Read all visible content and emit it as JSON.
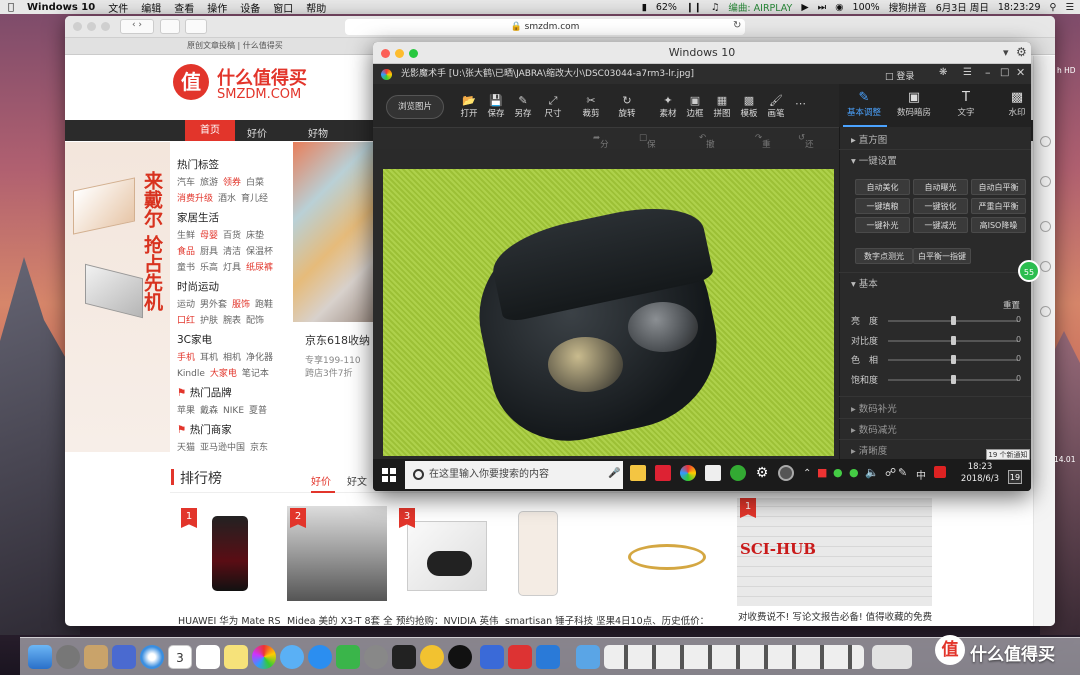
{
  "menubar": {
    "app": "Windows 10",
    "items": [
      "文件",
      "编辑",
      "查看",
      "操作",
      "设备",
      "窗口",
      "帮助"
    ],
    "battery_pct": "62%",
    "input": "编曲: AIRPLAY",
    "battery_status": "100%",
    "search_app": "搜狗拼音",
    "date": "6月3日 周日",
    "time": "18:23:29"
  },
  "safari": {
    "url": "smzdm.com",
    "tab_hint": "原创文章投稿 | 什么值得买"
  },
  "smzdm": {
    "logo_char": "值",
    "logo_cn": "什么值得买",
    "logo_en": "SMZDM.COM",
    "nav": [
      "首页",
      "好价",
      "好物"
    ],
    "banner_text": "来戴尔 抢占先机",
    "categories": [
      {
        "title": "热门标签",
        "rows": [
          [
            "汽车",
            "旅游",
            "领券",
            "白菜"
          ],
          [
            "消费升级",
            "酒水",
            "育儿经"
          ]
        ]
      },
      {
        "title": "家居生活",
        "rows": [
          [
            "生鲜",
            "母婴",
            "百货",
            "床垫"
          ],
          [
            "食品",
            "厨具",
            "清洁",
            "保温杯"
          ],
          [
            "童书",
            "乐高",
            "灯具",
            "纸尿裤"
          ]
        ]
      },
      {
        "title": "时尚运动",
        "rows": [
          [
            "运动",
            "男外套",
            "服饰",
            "跑鞋"
          ],
          [
            "口红",
            "护肤",
            "腕表",
            "配饰"
          ]
        ]
      },
      {
        "title": "3C家电",
        "rows": [
          [
            "手机",
            "耳机",
            "相机",
            "净化器"
          ],
          [
            "Kindle",
            "大家电",
            "笔记本"
          ]
        ]
      },
      {
        "title": "热门品牌",
        "rows": [
          [
            "苹果",
            "戴森",
            "NIKE",
            "夏普"
          ]
        ]
      },
      {
        "title": "热门商家",
        "rows": [
          [
            "天猫",
            "亚马逊中国",
            "京东"
          ]
        ]
      }
    ],
    "promo_title": "京东618收纳",
    "promo_sub1": "专享199-110",
    "promo_sub2": "跨店3件7折",
    "rank_title": "排行榜",
    "rank_tabs": [
      "好价",
      "好文",
      "好物",
      "海淘"
    ],
    "products": [
      {
        "rank": "1",
        "title": "HUAWEI 华为 Mate RS"
      },
      {
        "rank": "2",
        "title": "Midea 美的 X3-T 8套 全"
      },
      {
        "rank": "3",
        "title": "预约抢购：NVIDIA 英伟"
      },
      {
        "rank": "",
        "title": "smartisan 锤子科技 坚果"
      },
      {
        "rank": "",
        "title": "4日10点、历史低价："
      }
    ],
    "article_rank": "1",
    "article_image_text": "SCI-HUB",
    "article_title": "对收费说不! 写论文报告必备! 值得收藏的免费"
  },
  "vm": {
    "title": "Windows 10",
    "app_title": "光影魔术手  [U:\\张大鹤\\已晒\\JABRA\\缩改大小\\DSC03044-a7rm3-lr.jpg]",
    "login": "登录",
    "browse": "浏览图片",
    "tools": [
      "打开",
      "保存",
      "另存",
      "尺寸",
      "裁剪",
      "旋转",
      "素材",
      "边框",
      "拼图",
      "模板",
      "画笔"
    ],
    "subtools": [
      "分享",
      "保存动作",
      "撤销",
      "重做",
      "还原"
    ],
    "panel_tabs": [
      "基本调整",
      "数码暗房",
      "文字",
      "水印"
    ],
    "sections": {
      "histogram": "直方图",
      "oneclick": "一键设置",
      "basic": "基本",
      "reset": "重置",
      "digital_fill": "数码补光",
      "digital_reduce": "数码减光",
      "clarity": "清晰度"
    },
    "oneclick_buttons": [
      "自动美化",
      "自动曝光",
      "自动白平衡",
      "一键填粮",
      "一键锐化",
      "严重白平衡",
      "一键补光",
      "一键减光",
      "高ISO降噪"
    ],
    "extra_buttons": [
      "数字点测光",
      "白平衡一指键"
    ],
    "sliders": [
      {
        "label": "亮　度",
        "value": "0",
        "level": 0.5
      },
      {
        "label": "对比度",
        "value": "0",
        "level": 0.5
      },
      {
        "label": "色　相",
        "value": "0",
        "level": 0.5
      },
      {
        "label": "饱和度",
        "value": "0",
        "level": 0.5
      }
    ],
    "taskbar": {
      "search_placeholder": "在这里输入你要搜索的内容",
      "ime": "中",
      "time": "18:23",
      "date": "2018/6/3",
      "notifications": "19 个新通知",
      "notif_count": "19"
    }
  },
  "desktop": {
    "green_badge": "55",
    "right_label1": "h HD",
    "right_label2": "14.01"
  },
  "watermark": {
    "icon": "值",
    "text": "什么值得买"
  }
}
